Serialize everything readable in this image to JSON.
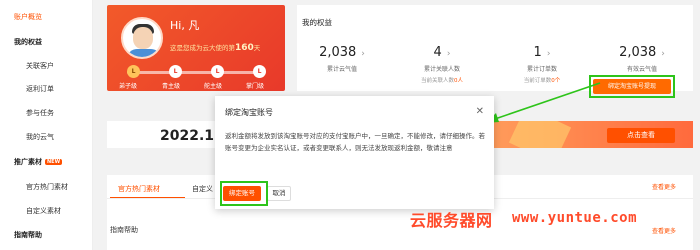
{
  "sidebar": {
    "items": [
      {
        "label": "账户概览",
        "active": true
      },
      {
        "label": "我的权益",
        "group": true
      },
      {
        "label": "关联客户"
      },
      {
        "label": "返利订单"
      },
      {
        "label": "参与任务"
      },
      {
        "label": "我的云气"
      },
      {
        "label": "推广素材",
        "group": true,
        "badge": "NEW"
      },
      {
        "label": "官方热门素材"
      },
      {
        "label": "自定义素材"
      },
      {
        "label": "指南帮助",
        "group": true
      }
    ]
  },
  "profile": {
    "greeting": "Hi, ",
    "username": "凡",
    "days_prefix": "这是您成为云大使的第",
    "days": "160",
    "days_suffix": "天",
    "levels": [
      "弟子级",
      "青主级",
      "舵主级",
      "掌门级"
    ]
  },
  "rights": {
    "title": "我的权益",
    "stats": [
      {
        "value": "2,038",
        "label": "累计云气值",
        "note": ""
      },
      {
        "value": "4",
        "label": "累计关联人数",
        "note_prefix": "当前关联人数",
        "note_value": "0人"
      },
      {
        "value": "1",
        "label": "累计订单数",
        "note_prefix": "当前订单数",
        "note_value": "0个"
      },
      {
        "value": "2,038",
        "label": "有效云气值",
        "note": ""
      }
    ],
    "bind_button": "绑定淘宝账号提现"
  },
  "ad": {
    "date": "2022.1.",
    "button": "点击查看"
  },
  "tabs": {
    "items": [
      "官方热门素材",
      "自定义"
    ],
    "see_more": "查看更多"
  },
  "guide": {
    "title": "指南帮助",
    "see_more": "查看更多"
  },
  "modal": {
    "title": "绑定淘宝账号",
    "body": "返利金额将发放到该淘宝账号对应的支付宝账户中，一旦确定，不能修改，请仔细操作。若账号变更为企业实名认证，或者变更联系人，则无法发放现返利金额，敬请注意",
    "ok": "绑定账号",
    "cancel": "取消"
  },
  "watermark": {
    "text": "云服务器网",
    "url": "www.yuntue.com"
  },
  "colors": {
    "accent": "#ff5000",
    "highlight": "#2ec41a",
    "banner": "#e8392a"
  }
}
